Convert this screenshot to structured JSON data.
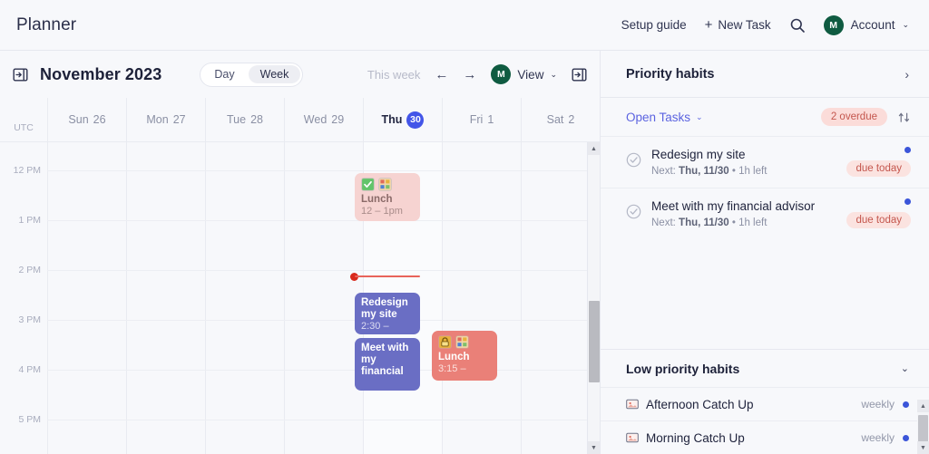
{
  "header": {
    "app_title": "Planner",
    "setup_guide": "Setup guide",
    "new_task": "New Task",
    "new_task_plus": "+",
    "search_icon": "search-icon",
    "account_label": "Account",
    "account_initial": "M",
    "chevron": "⌄"
  },
  "calendar": {
    "sidebar_toggle_icon": "panel-expand-icon",
    "month_label": "November 2023",
    "view_modes": [
      {
        "label": "Day",
        "selected": false
      },
      {
        "label": "Week",
        "selected": true
      }
    ],
    "this_week": "This week",
    "prev_arrow": "←",
    "next_arrow": "→",
    "view_avatar_initial": "M",
    "view_label": "View",
    "panel_toggle_icon": "panel-collapse-icon",
    "timezone": "UTC",
    "days": [
      {
        "name": "Sun",
        "num": "26",
        "today": false
      },
      {
        "name": "Mon",
        "num": "27",
        "today": false
      },
      {
        "name": "Tue",
        "num": "28",
        "today": false
      },
      {
        "name": "Wed",
        "num": "29",
        "today": false
      },
      {
        "name": "Thu",
        "num": "30",
        "today": true
      },
      {
        "name": "Fri",
        "num": "1",
        "today": false
      },
      {
        "name": "Sat",
        "num": "2",
        "today": false
      }
    ],
    "hours": [
      "12 PM",
      "1 PM",
      "2 PM",
      "3 PM",
      "4 PM",
      "5 PM"
    ],
    "now_indicator_color": "#d8291c",
    "events": [
      {
        "title": "Lunch",
        "time": "12 – 1pm",
        "color": "#f6d3d1",
        "style": "pink",
        "day": 4,
        "icons": [
          "check-badge-icon",
          "grid-badge-icon"
        ]
      },
      {
        "title": "Redesign my site",
        "time": "2:30 –",
        "color": "#6a6ec4",
        "style": "purple",
        "day": 4,
        "icons": []
      },
      {
        "title": "Meet with my financial",
        "time": "",
        "color": "#6a6ec4",
        "style": "purple",
        "day": 4,
        "icons": []
      },
      {
        "title": "Lunch",
        "time": "3:15 –",
        "color": "#ea8078",
        "style": "salmon",
        "day": 5,
        "icons": [
          "lock-badge-icon",
          "grid-badge-icon"
        ]
      }
    ]
  },
  "sidepanel": {
    "priority_title": "Priority habits",
    "priority_chevron": "›",
    "open_tasks_label": "Open Tasks",
    "open_tasks_chevron": "⌄",
    "overdue_badge": "2 overdue",
    "sort_icon": "sort-icon",
    "tasks": [
      {
        "title": "Redesign my site",
        "next_prefix": "Next: ",
        "next_date": "Thu, 11/30",
        "next_suffix": " • 1h left",
        "badge": "due today",
        "dot_color": "#3b55d9",
        "check_icon": "check-circle-icon"
      },
      {
        "title": "Meet with my financial advisor",
        "next_prefix": "Next: ",
        "next_date": "Thu, 11/30",
        "next_suffix": " • 1h left",
        "badge": "due today",
        "dot_color": "#3b55d9",
        "check_icon": "check-circle-icon"
      }
    ],
    "low_title": "Low priority habits",
    "low_chevron": "⌄",
    "habits": [
      {
        "title": "Afternoon Catch Up",
        "freq": "weekly",
        "icon": "image-badge-icon",
        "dot_color": "#3b55d9"
      },
      {
        "title": "Morning Catch Up",
        "freq": "weekly",
        "icon": "image-badge-icon",
        "dot_color": "#3b55d9"
      }
    ]
  }
}
